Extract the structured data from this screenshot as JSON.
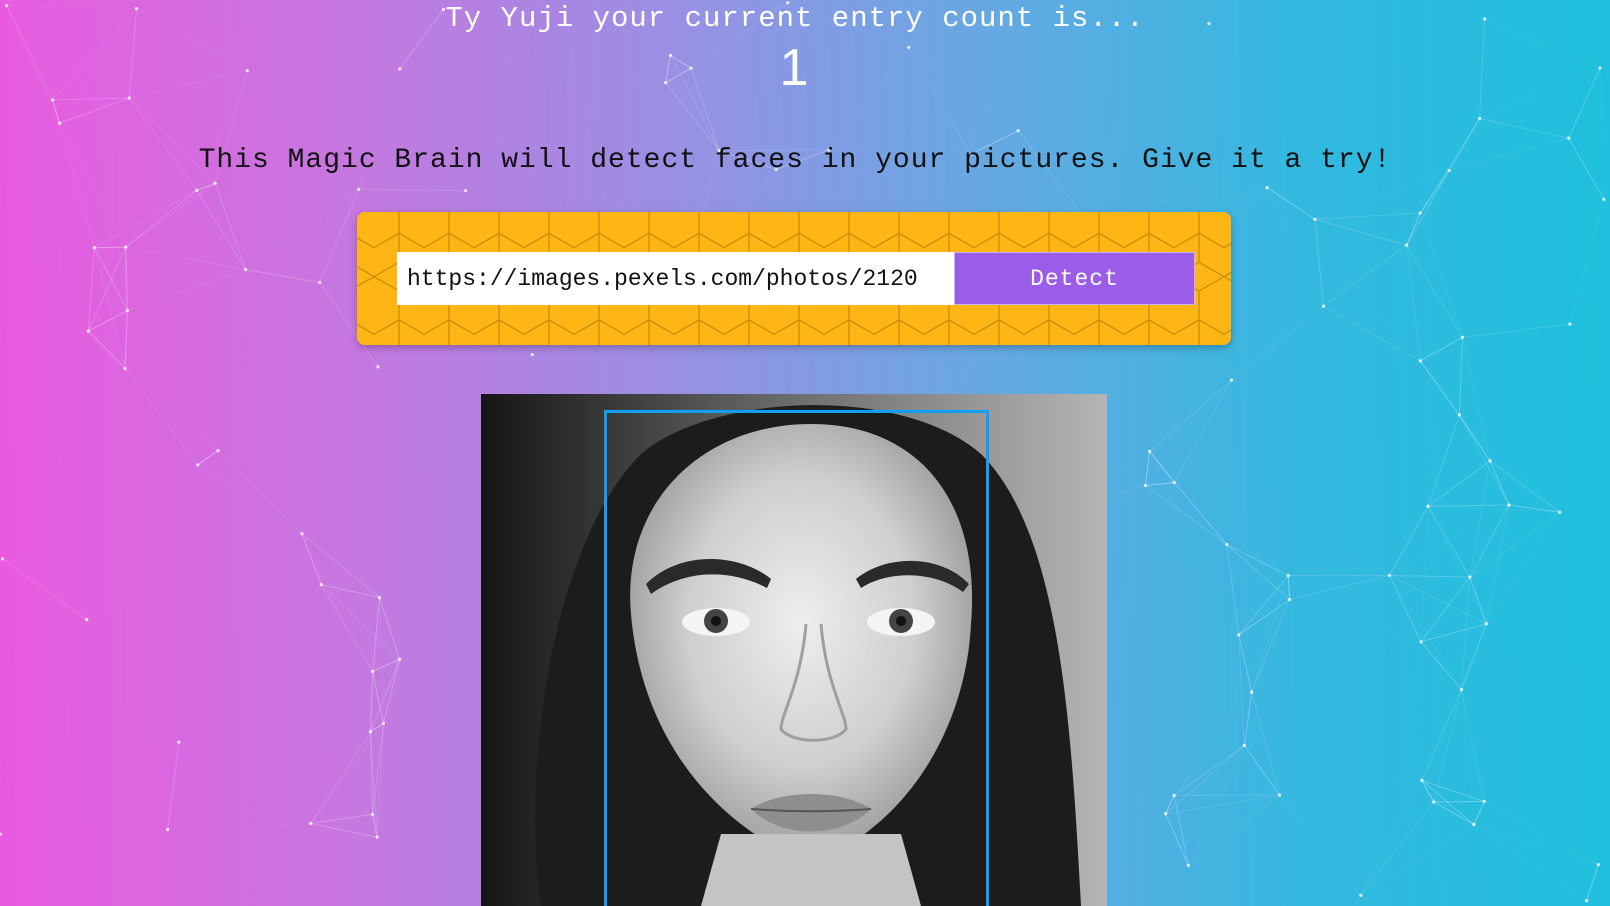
{
  "rank": {
    "message": "Ty Yuji your current entry count is...",
    "count": "1"
  },
  "intro": {
    "text": "This Magic Brain will detect faces in your pictures. Give it a try!"
  },
  "image_form": {
    "url_value": "https://images.pexels.com/photos/2120",
    "detect_label": "Detect"
  },
  "colors": {
    "gradient_left": "#ea5ae0",
    "gradient_right": "#1ec0dd",
    "card_yellow": "#fdb614",
    "button_purple": "#9b5de8",
    "box_blue": "#149df2"
  }
}
